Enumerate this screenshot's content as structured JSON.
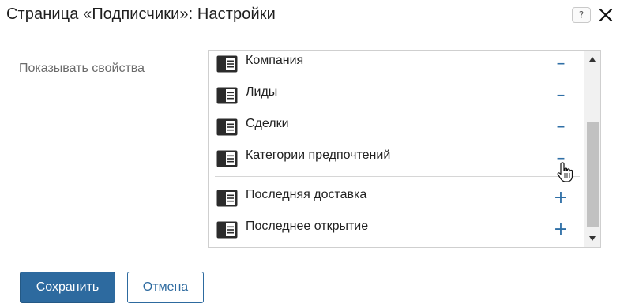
{
  "dialog": {
    "title": "Страница «Подписчики»: Настройки",
    "help_label": "?"
  },
  "field": {
    "label": "Показывать свойства"
  },
  "properties": [
    {
      "label": "Компания",
      "action": "–",
      "icon": "property-card-icon",
      "state": "shown"
    },
    {
      "label": "Лиды",
      "action": "–",
      "icon": "property-card-icon",
      "state": "shown"
    },
    {
      "label": "Сделки",
      "action": "–",
      "icon": "property-card-icon",
      "state": "shown"
    },
    {
      "label": "Категории предпочтений",
      "action": "–",
      "icon": "property-card-icon",
      "state": "shown"
    },
    {
      "label": "Последняя доставка",
      "action": "+",
      "icon": "property-card-icon",
      "state": "hidden"
    },
    {
      "label": "Последнее открытие",
      "action": "+",
      "icon": "property-card-icon",
      "state": "hidden"
    }
  ],
  "buttons": {
    "save_label": "Сохранить",
    "cancel_label": "Отмена"
  },
  "colors": {
    "accent": "#2d6a9f",
    "action_icon": "#2f6fa6",
    "icon_dark": "#2b2b2b"
  }
}
